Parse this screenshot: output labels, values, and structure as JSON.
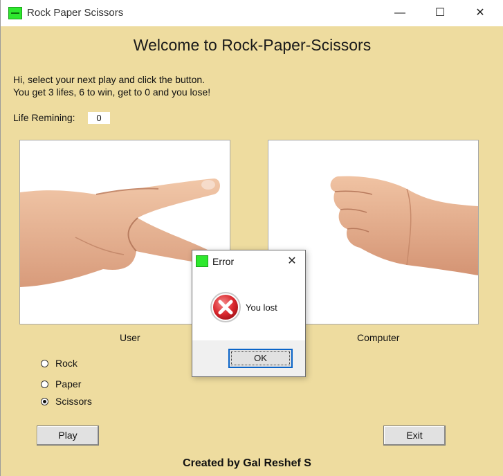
{
  "window": {
    "title": "Rock Paper Scissors",
    "minimize_glyph": "—",
    "maximize_glyph": "☐",
    "close_glyph": "✕"
  },
  "header": {
    "title": "Welcome to Rock-Paper-Scissors"
  },
  "intro": {
    "line1": "Hi, select your next play and click the button.",
    "line2": "You get 3 lifes, 6 to win, get to 0  and you lose!"
  },
  "life": {
    "label": "Life Remining:",
    "value": "0"
  },
  "panels": {
    "user_caption": "User",
    "computer_caption": "Computer",
    "user_image": "scissors-hand-image",
    "computer_image": "rock-fist-image"
  },
  "options": [
    {
      "label": "Rock",
      "checked": false
    },
    {
      "label": "Paper",
      "checked": false
    },
    {
      "label": "Scissors",
      "checked": true
    }
  ],
  "buttons": {
    "play": "Play",
    "exit": "Exit"
  },
  "credit": "Created by Gal Reshef S",
  "dialog": {
    "title": "Error",
    "close_glyph": "✕",
    "message": "You lost",
    "ok": "OK",
    "icon": "error-icon"
  },
  "colors": {
    "background": "#eedc9f",
    "app_icon": "#2ee82e",
    "error_red": "#d9262c",
    "focus_border": "#0a64c8"
  }
}
